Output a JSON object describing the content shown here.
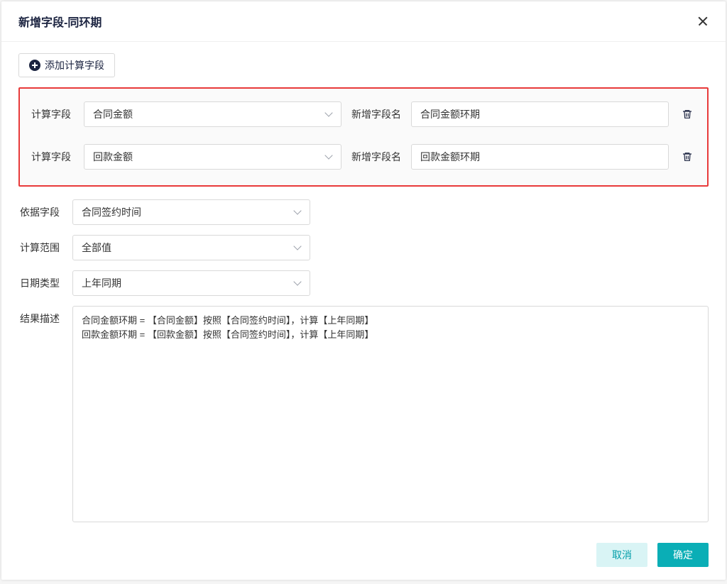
{
  "dialog": {
    "title": "新增字段-同环期",
    "add_calc_field_label": "添加计算字段",
    "rows": [
      {
        "calc_label": "计算字段",
        "calc_value": "合同金额",
        "new_label": "新增字段名",
        "new_value": "合同金额环期"
      },
      {
        "calc_label": "计算字段",
        "calc_value": "回款金额",
        "new_label": "新增字段名",
        "new_value": "回款金额环期"
      }
    ],
    "basis_field_label": "依据字段",
    "basis_field_value": "合同签约时间",
    "calc_range_label": "计算范围",
    "calc_range_value": "全部值",
    "date_type_label": "日期类型",
    "date_type_value": "上年同期",
    "result_desc_label": "结果描述",
    "result_desc_value": "合同金额环期 = 【合同金额】按照【合同签约时间】，计算【上年同期】\n回款金额环期 = 【回款金额】按照【合同签约时间】，计算【上年同期】",
    "cancel_label": "取消",
    "ok_label": "确定"
  }
}
